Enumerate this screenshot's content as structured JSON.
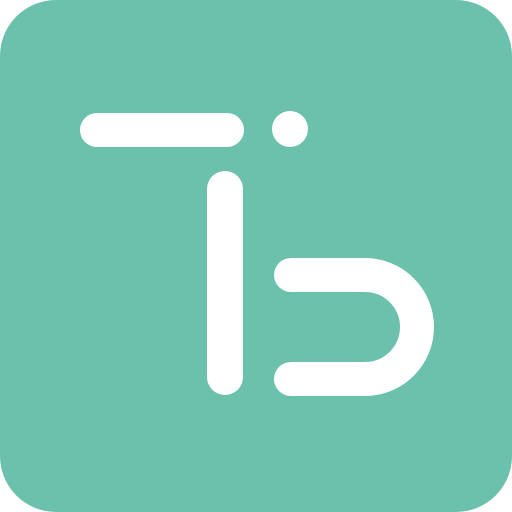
{
  "app_icon": {
    "icon_name": "tb-logo-icon",
    "colors": {
      "background": "#6cc1ac",
      "glyph": "#ffffff"
    }
  }
}
